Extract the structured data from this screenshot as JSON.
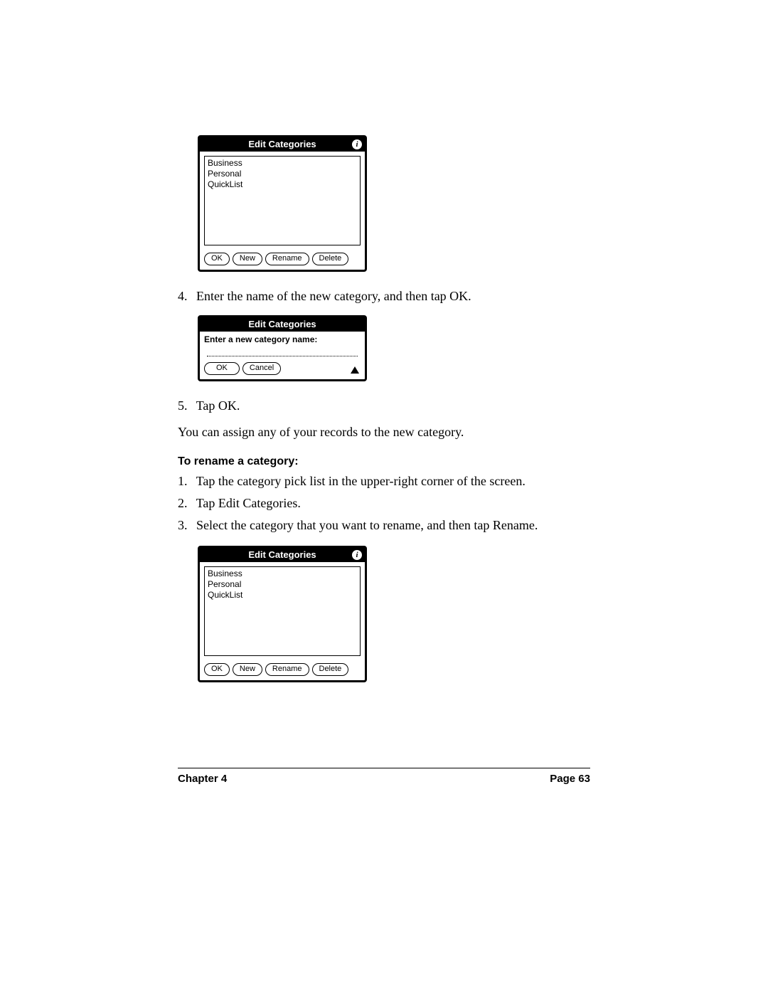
{
  "dialog1": {
    "title": "Edit Categories",
    "info_glyph": "i",
    "items": [
      "Business",
      "Personal",
      "QuickList"
    ],
    "buttons": {
      "ok": "OK",
      "new": "New",
      "rename": "Rename",
      "delete": "Delete"
    }
  },
  "step4": {
    "num": "4.",
    "text": "Enter the name of the new category, and then tap OK."
  },
  "dialog2": {
    "title": "Edit Categories",
    "prompt": "Enter a new category name:",
    "buttons": {
      "ok": "OK",
      "cancel": "Cancel"
    }
  },
  "step5": {
    "num": "5.",
    "text": "Tap OK."
  },
  "para1": "You can assign any of your records to the new category.",
  "subhead": "To rename a category:",
  "rename_steps": [
    {
      "num": "1.",
      "text": "Tap the category pick list in the upper-right corner of the screen."
    },
    {
      "num": "2.",
      "text": "Tap Edit Categories."
    },
    {
      "num": "3.",
      "text": "Select the category that you want to rename, and then tap Rename."
    }
  ],
  "dialog3": {
    "title": "Edit Categories",
    "info_glyph": "i",
    "items": [
      "Business",
      "Personal",
      "QuickList"
    ],
    "buttons": {
      "ok": "OK",
      "new": "New",
      "rename": "Rename",
      "delete": "Delete"
    }
  },
  "footer": {
    "chapter": "Chapter 4",
    "page": "Page 63"
  }
}
